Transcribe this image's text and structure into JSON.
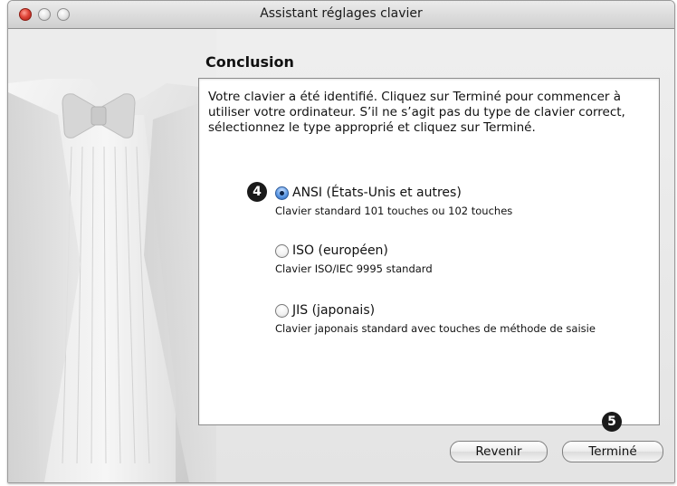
{
  "window": {
    "title": "Assistant réglages clavier"
  },
  "main": {
    "heading": "Conclusion",
    "intro": "Votre clavier a été identifié. Cliquez sur Terminé pour commencer à utiliser votre ordinateur. S’il ne s’agit pas du type de clavier correct, sélectionnez le type approprié et cliquez sur Terminé.",
    "options": [
      {
        "label": "ANSI (États-Unis et autres)",
        "desc": "Clavier standard 101 touches ou 102 touches",
        "selected": true
      },
      {
        "label": "ISO (européen)",
        "desc": "Clavier ISO/IEC 9995 standard",
        "selected": false
      },
      {
        "label": "JIS (japonais)",
        "desc": "Clavier japonais standard avec touches de méthode de saisie",
        "selected": false
      }
    ]
  },
  "callouts": {
    "c4": "4",
    "c5": "5"
  },
  "buttons": {
    "back": "Revenir",
    "done": "Terminé"
  }
}
